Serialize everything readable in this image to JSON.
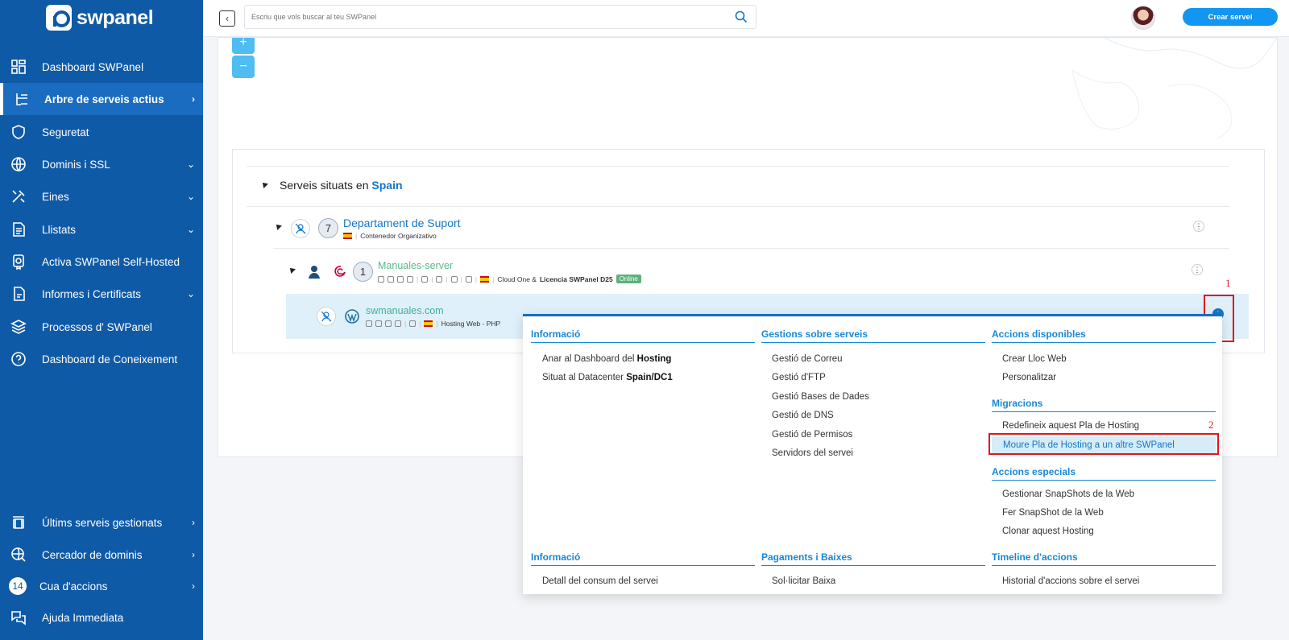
{
  "brand": {
    "name": "swpanel"
  },
  "sidebar": {
    "items": [
      {
        "label": "Dashboard SWPanel",
        "icon": "dashboard-icon",
        "arrow": ""
      },
      {
        "label": "Arbre de serveis actius",
        "icon": "tree-icon",
        "arrow": "›"
      },
      {
        "label": "Seguretat",
        "icon": "shield-icon",
        "arrow": ""
      },
      {
        "label": "Dominis i SSL",
        "icon": "www-icon",
        "arrow": "⌄"
      },
      {
        "label": "Eines",
        "icon": "tools-icon",
        "arrow": "⌄"
      },
      {
        "label": "Llistats",
        "icon": "list-icon",
        "arrow": "⌄"
      },
      {
        "label": "Activa SWPanel Self-Hosted",
        "icon": "certificate-icon",
        "arrow": ""
      },
      {
        "label": "Informes i Certificats",
        "icon": "report-icon",
        "arrow": "⌄"
      },
      {
        "label": "Processos d' SWPanel",
        "icon": "layers-icon",
        "arrow": ""
      },
      {
        "label": "Dashboard de Coneixement",
        "icon": "help-icon",
        "arrow": ""
      }
    ],
    "bottom": [
      {
        "label": "Últims serveis gestionats",
        "icon": "history-icon",
        "arrow": "›"
      },
      {
        "label": "Cercador de dominis",
        "icon": "globe-search-icon",
        "arrow": "›"
      },
      {
        "label": "Cua d'accions",
        "badge": "14",
        "arrow": "›"
      },
      {
        "label": "Ajuda Immediata",
        "icon": "chat-icon",
        "arrow": ""
      }
    ]
  },
  "topbar": {
    "search_placeholder": "Escriu que vols buscar al teu SWPanel",
    "create_label": "Crear servei"
  },
  "map": {
    "zoom_in": "+",
    "zoom_out": "−"
  },
  "services": {
    "title_prefix": "Serveis situats en",
    "title_location": "Spain",
    "department": {
      "count": "7",
      "name": "Departament de Suport",
      "meta": "Contenedor Organizativo"
    },
    "server": {
      "count": "1",
      "name": "Manuales-server",
      "meta_plan": "Cloud One &",
      "meta_license": "Licencia SWPanel D25",
      "status": "Online"
    },
    "hosting": {
      "name": "swmanuales.com",
      "meta": "Hosting Web - PHP"
    }
  },
  "annotations": {
    "one": "1",
    "two": "2"
  },
  "menu": {
    "col1": {
      "header": "Informació",
      "items": [
        {
          "pre": "Anar al Dashboard del ",
          "bold": "Hosting"
        },
        {
          "pre": "Situat al Datacenter ",
          "bold": "Spain/DC1"
        }
      ],
      "header2": "Informació",
      "items2": [
        "Detall del consum del servei"
      ]
    },
    "col2": {
      "header": "Gestions sobre serveis",
      "items": [
        "Gestió de Correu",
        "Gestió d'FTP",
        "Gestió Bases de Dades",
        "Gestió de DNS",
        "Gestió de Permisos",
        "Servidors del servei"
      ],
      "header2": "Pagaments i Baixes",
      "items2": [
        "Sol·licitar Baixa"
      ]
    },
    "col3": {
      "header": "Accions disponibles",
      "items": [
        "Crear Lloc Web",
        "Personalitzar"
      ],
      "migr_header": "Migracions",
      "migr_items": [
        "Redefineix aquest Pla de Hosting",
        "Moure Pla de Hosting a un altre SWPanel"
      ],
      "esp_header": "Accions especials",
      "esp_items": [
        "Gestionar SnapShots de la Web",
        "Fer SnapShot de la Web",
        "Clonar aquest Hosting"
      ],
      "header2": "Timeline d'accions",
      "items2": [
        "Historial d'accions sobre el servei"
      ]
    }
  }
}
